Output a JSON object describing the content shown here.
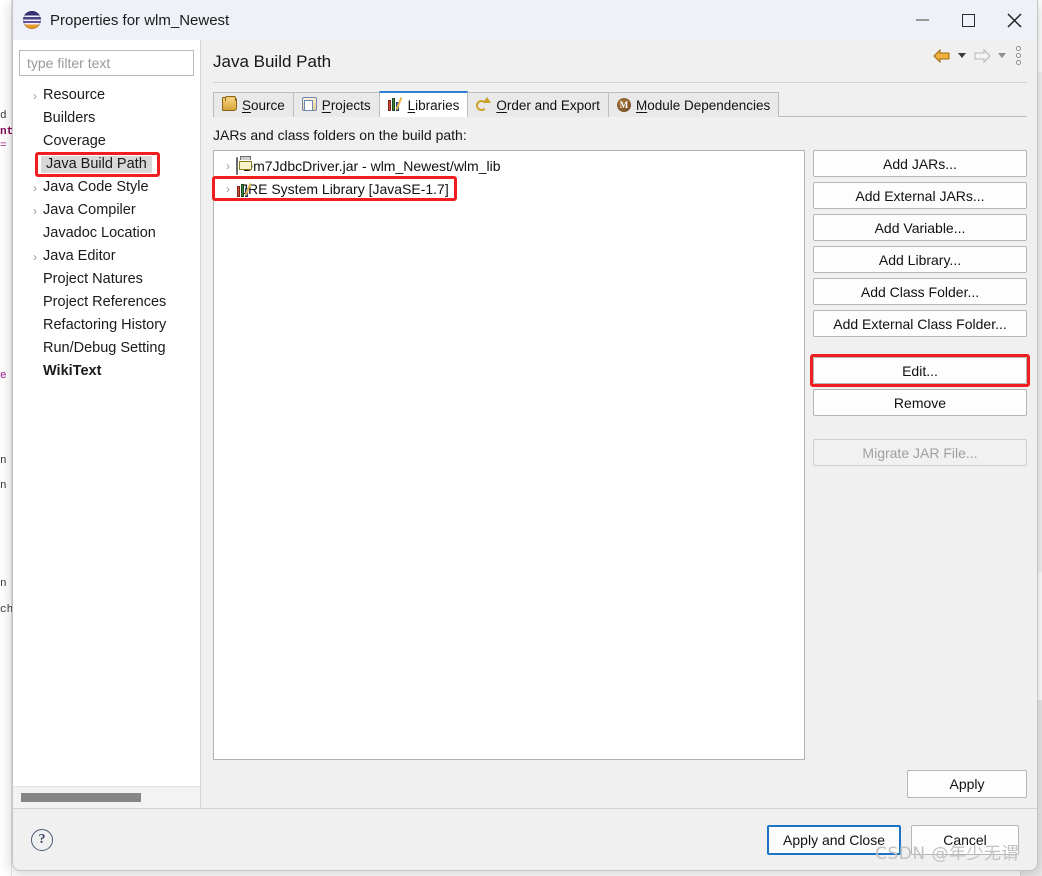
{
  "window": {
    "title": "Properties for wlm_Newest",
    "icon": "eclipse-logo",
    "minimize": "minimize",
    "maximize": "maximize",
    "close": "close"
  },
  "sidebar": {
    "filter_placeholder": "type filter text",
    "filter_value": "",
    "items": [
      {
        "label": "Resource",
        "expandable": true,
        "selected": false,
        "bold": false
      },
      {
        "label": "Builders",
        "expandable": false,
        "selected": false,
        "bold": false
      },
      {
        "label": "Coverage",
        "expandable": false,
        "selected": false,
        "bold": false
      },
      {
        "label": "Java Build Path",
        "expandable": false,
        "selected": true,
        "bold": false
      },
      {
        "label": "Java Code Style",
        "expandable": true,
        "selected": false,
        "bold": false
      },
      {
        "label": "Java Compiler",
        "expandable": true,
        "selected": false,
        "bold": false
      },
      {
        "label": "Javadoc Location",
        "expandable": false,
        "selected": false,
        "bold": false
      },
      {
        "label": "Java Editor",
        "expandable": true,
        "selected": false,
        "bold": false
      },
      {
        "label": "Project Natures",
        "expandable": false,
        "selected": false,
        "bold": false
      },
      {
        "label": "Project References",
        "expandable": false,
        "selected": false,
        "bold": false
      },
      {
        "label": "Refactoring History",
        "expandable": false,
        "selected": false,
        "bold": false
      },
      {
        "label": "Run/Debug Setting",
        "expandable": false,
        "selected": false,
        "bold": false
      },
      {
        "label": "WikiText",
        "expandable": false,
        "selected": false,
        "bold": true
      }
    ]
  },
  "page": {
    "title": "Java Build Path",
    "list_caption": "JARs and class folders on the build path:"
  },
  "tabs": [
    {
      "label": "Source",
      "icon": "source-folder-icon",
      "active": false
    },
    {
      "label": "Projects",
      "icon": "project-folder-icon",
      "active": false
    },
    {
      "label": "Libraries",
      "icon": "library-books-icon",
      "active": true
    },
    {
      "label": "Order and Export",
      "icon": "order-export-icon",
      "active": false
    },
    {
      "label": "Module Dependencies",
      "icon": "module-dependencies-icon",
      "active": false
    }
  ],
  "jar_list": [
    {
      "label": "Dm7JdbcDriver.jar - wlm_Newest/wlm_lib",
      "icon": "jar-file-icon",
      "expandable": true,
      "annotated": false
    },
    {
      "label": "JRE System Library [JavaSE-1.7]",
      "icon": "library-books-icon",
      "expandable": true,
      "annotated": true
    }
  ],
  "side_buttons": [
    {
      "label": "Add JARs...",
      "enabled": true,
      "annotated": false
    },
    {
      "label": "Add External JARs...",
      "enabled": true,
      "annotated": false
    },
    {
      "label": "Add Variable...",
      "enabled": true,
      "annotated": false
    },
    {
      "label": "Add Library...",
      "enabled": true,
      "annotated": false
    },
    {
      "label": "Add Class Folder...",
      "enabled": true,
      "annotated": false
    },
    {
      "label": "Add External Class Folder...",
      "enabled": true,
      "annotated": false
    },
    {
      "label": "Edit...",
      "enabled": true,
      "annotated": true
    },
    {
      "label": "Remove",
      "enabled": true,
      "annotated": false
    },
    {
      "label": "Migrate JAR File...",
      "enabled": false,
      "annotated": false
    }
  ],
  "apply_button": "Apply",
  "footer": {
    "help": "?",
    "apply_and_close": "Apply and Close",
    "cancel": "Cancel"
  },
  "navigation": {
    "back": "back-arrow",
    "back_menu": "back-dropdown",
    "forward": "forward-arrow",
    "forward_menu": "forward-dropdown",
    "menu": "view-menu"
  },
  "watermark": "CSDN @年少无谓",
  "colors": {
    "accent": "#2f7fd1",
    "annotation": "#f01e1e",
    "dialog_bg": "#f0f0f0",
    "titlebar_bg": "#eef1f8",
    "selection": "#d8d8d8"
  },
  "background_code": [
    "d .",
    "nt",
    "=",
    "e",
    "n .",
    "n .",
    "n",
    "ch"
  ]
}
